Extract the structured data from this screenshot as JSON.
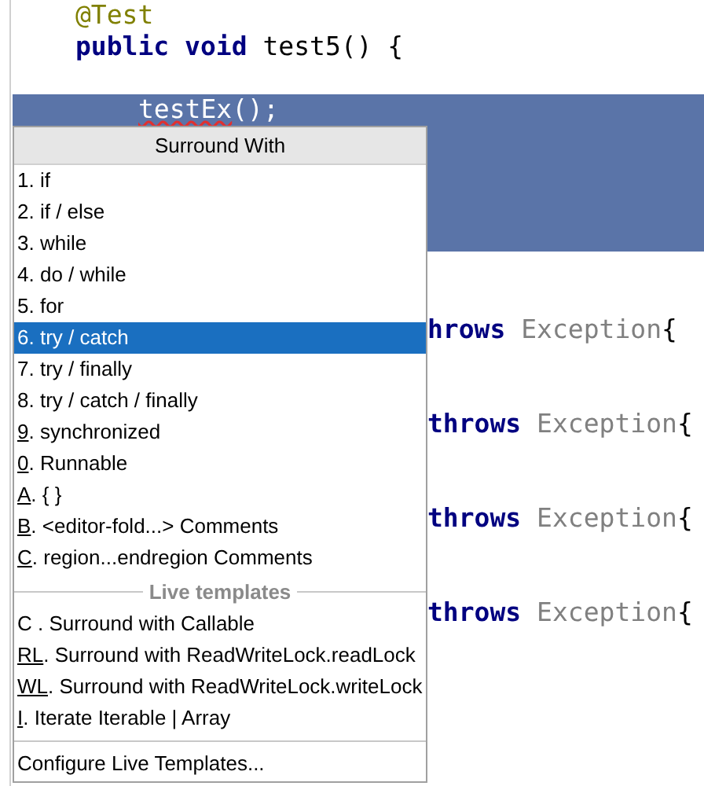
{
  "editor": {
    "lines": [
      {
        "kind": "code",
        "segments": [
          {
            "text": "@Test",
            "kind": "annotation"
          }
        ]
      },
      {
        "kind": "code",
        "segments": [
          {
            "text": "public",
            "kind": "keyword"
          },
          {
            "text": " void",
            "kind": "keyword"
          },
          {
            "text": " test5() {",
            "kind": "plain"
          }
        ]
      },
      {
        "kind": "blank"
      },
      {
        "kind": "selected_indented",
        "segments": [
          {
            "text": "testEx",
            "kind": "plain",
            "error": true
          },
          {
            "text": "();",
            "kind": "plain"
          }
        ]
      },
      {
        "kind": "selected_blank"
      },
      {
        "kind": "selected_blank"
      },
      {
        "kind": "selected_blank"
      },
      {
        "kind": "selected_blank"
      },
      {
        "kind": "blank"
      },
      {
        "kind": "blank"
      },
      {
        "kind": "clipped",
        "segments": [
          {
            "text": "hrows",
            "kind": "keyword"
          },
          {
            "text": " Exception",
            "kind": "type"
          },
          {
            "text": "{",
            "kind": "plain"
          }
        ]
      },
      {
        "kind": "blank"
      },
      {
        "kind": "blank"
      },
      {
        "kind": "clipped",
        "segments": [
          {
            "text": "throws",
            "kind": "keyword"
          },
          {
            "text": " Exception",
            "kind": "type"
          },
          {
            "text": "{",
            "kind": "plain"
          }
        ]
      },
      {
        "kind": "blank"
      },
      {
        "kind": "blank"
      },
      {
        "kind": "clipped",
        "segments": [
          {
            "text": "throws",
            "kind": "keyword"
          },
          {
            "text": " Exception",
            "kind": "type"
          },
          {
            "text": "{",
            "kind": "plain"
          }
        ]
      },
      {
        "kind": "blank"
      },
      {
        "kind": "blank"
      },
      {
        "kind": "clipped",
        "segments": [
          {
            "text": "throws",
            "kind": "keyword"
          },
          {
            "text": " Exception",
            "kind": "type"
          },
          {
            "text": "{",
            "kind": "plain"
          }
        ]
      }
    ]
  },
  "popup": {
    "title": "Surround With",
    "items": [
      {
        "mnemonic": "1",
        "text": ". if",
        "underlined": false,
        "selected": false
      },
      {
        "mnemonic": "2",
        "text": ". if / else",
        "underlined": false,
        "selected": false
      },
      {
        "mnemonic": "3",
        "text": ". while",
        "underlined": false,
        "selected": false
      },
      {
        "mnemonic": "4",
        "text": ". do / while",
        "underlined": false,
        "selected": false
      },
      {
        "mnemonic": "5",
        "text": ". for",
        "underlined": false,
        "selected": false
      },
      {
        "mnemonic": "6",
        "text": ". try / catch",
        "underlined": false,
        "selected": true
      },
      {
        "mnemonic": "7",
        "text": ". try / finally",
        "underlined": false,
        "selected": false
      },
      {
        "mnemonic": "8",
        "text": ". try / catch / finally",
        "underlined": false,
        "selected": false
      },
      {
        "mnemonic": "9",
        "text": ". synchronized",
        "underlined": true,
        "selected": false
      },
      {
        "mnemonic": "0",
        "text": ". Runnable",
        "underlined": true,
        "selected": false
      },
      {
        "mnemonic": "A",
        "text": ". { }",
        "underlined": true,
        "selected": false
      },
      {
        "mnemonic": "B",
        "text": ". <editor-fold...> Comments",
        "underlined": true,
        "selected": false
      },
      {
        "mnemonic": "C",
        "text": ". region...endregion Comments",
        "underlined": true,
        "selected": false
      }
    ],
    "section_title": "Live templates",
    "template_items": [
      {
        "mnemonic": "C",
        "text": " . Surround with Callable",
        "underlined": false,
        "selected": false
      },
      {
        "mnemonic": "RL",
        "text": ". Surround with ReadWriteLock.readLock",
        "underlined": true,
        "selected": false
      },
      {
        "mnemonic": "WL",
        "text": ". Surround with ReadWriteLock.writeLock",
        "underlined": true,
        "selected": false
      },
      {
        "mnemonic": "I",
        "text": ". Iterate Iterable | Array",
        "underlined": true,
        "selected": false
      }
    ],
    "footer": "Configure Live Templates..."
  }
}
